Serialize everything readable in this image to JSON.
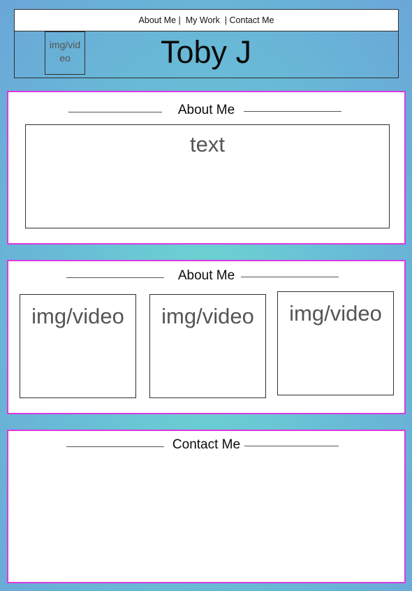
{
  "header": {
    "nav": [
      {
        "label": "About Me"
      },
      {
        "label": "My Work"
      },
      {
        "label": "Contact Me"
      }
    ],
    "separator": "|",
    "logo_placeholder": "img/video",
    "title": "Toby J"
  },
  "sections": [
    {
      "heading": "About Me",
      "text_placeholder": "text"
    },
    {
      "heading": "About Me",
      "media": [
        "img/video",
        "img/video",
        "img/video"
      ]
    },
    {
      "heading": "Contact Me"
    }
  ],
  "colors": {
    "section_border": "#d93be0",
    "background_center": "#6dd8d0",
    "background_edge": "#6aa6d8"
  }
}
